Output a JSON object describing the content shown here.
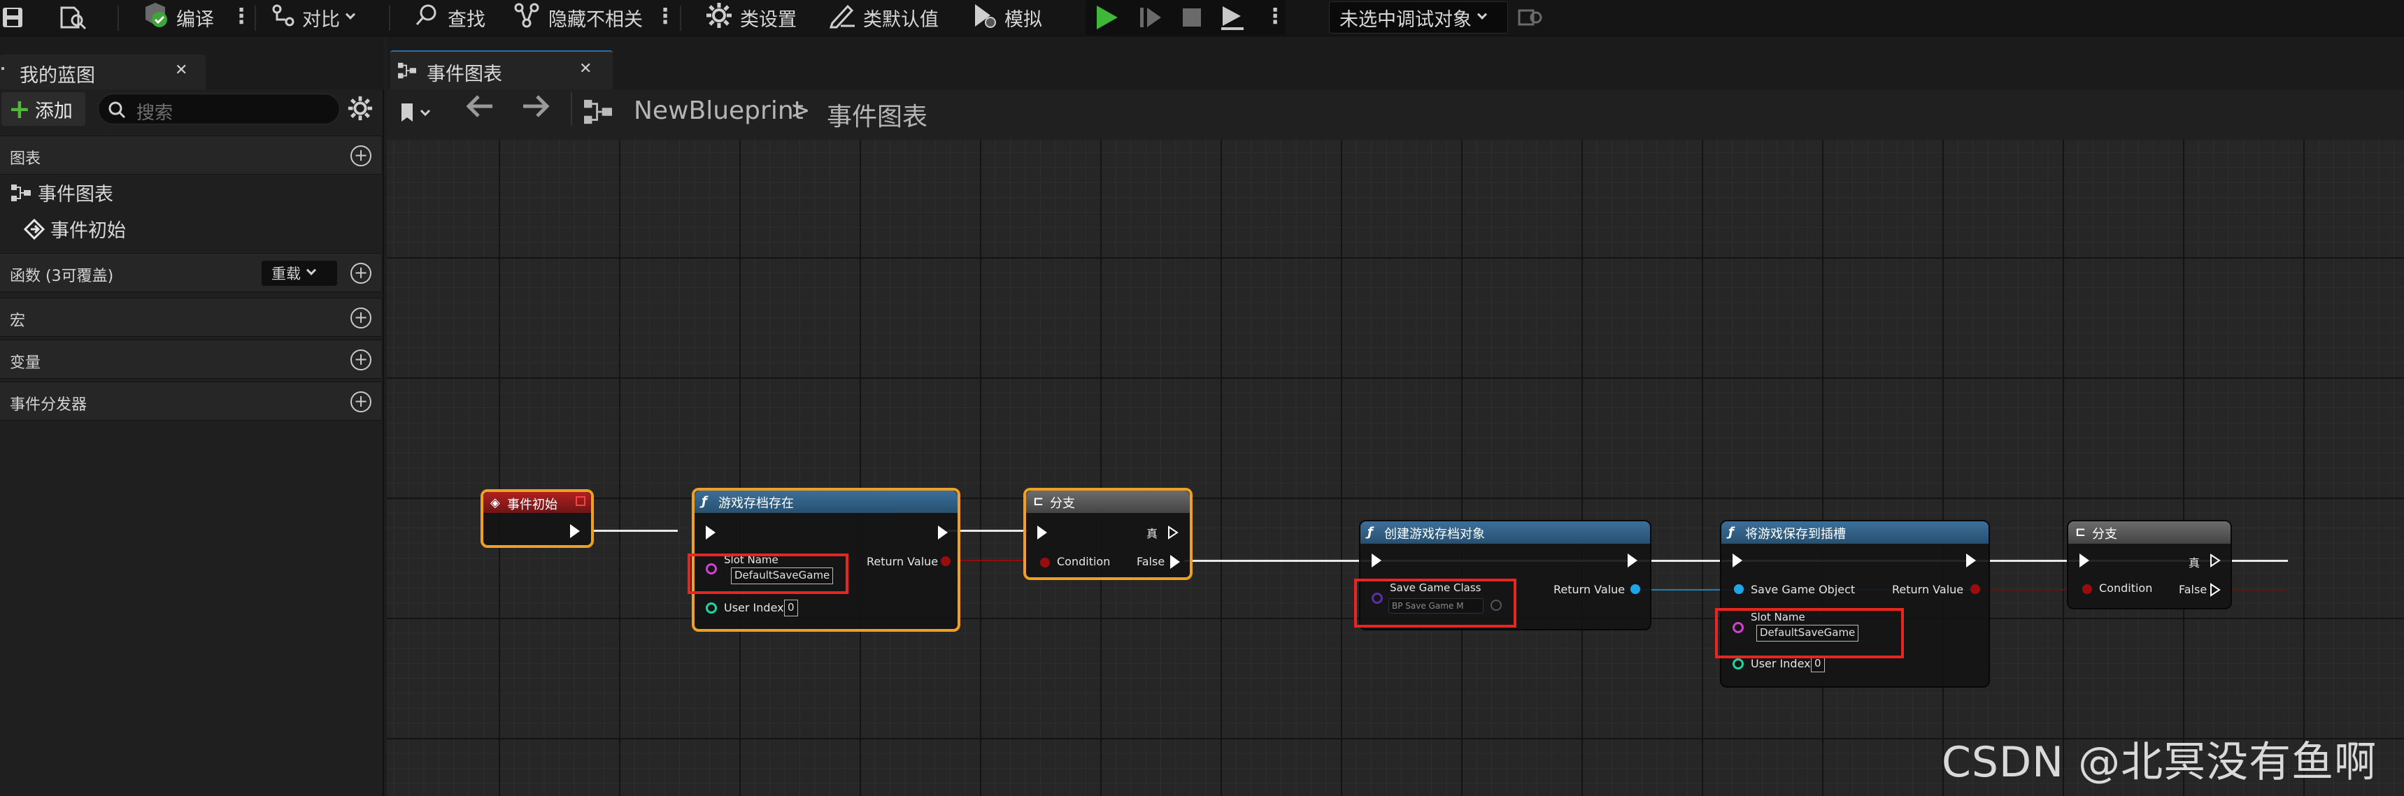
{
  "toolbar": {
    "compile": "编译",
    "diff": "对比",
    "find": "查找",
    "hide_unrelated": "隐藏不相关",
    "class_settings": "类设置",
    "class_defaults": "类默认值",
    "simulate": "模拟",
    "debug_target": "未选中调试对象"
  },
  "left": {
    "tab_label": "我的蓝图",
    "add_label": "添加",
    "search_placeholder": "搜索",
    "sections": {
      "graphs": "图表",
      "functions": "函数 (3可覆盖)",
      "override_label": "重载",
      "macros": "宏",
      "variables": "变量",
      "dispatchers": "事件分发器"
    },
    "graph_items": [
      "事件图表",
      "事件初始"
    ]
  },
  "graph": {
    "tab_label": "事件图表",
    "breadcrumb_root": "NewBlueprint",
    "breadcrumb_leaf": "事件图表"
  },
  "nodes": {
    "begin_play": {
      "title": "事件初始"
    },
    "does_save_exist": {
      "title": "游戏存档存在",
      "slot_name_label": "Slot Name",
      "slot_name_value": "DefaultSaveGame",
      "return_label": "Return Value",
      "user_index_label": "User Index",
      "user_index_value": "0"
    },
    "branch1": {
      "title": "分支",
      "condition": "Condition",
      "true_label": "真",
      "false_label": "False"
    },
    "create_save": {
      "title": "创建游戏存档对象",
      "class_label": "Save Game Class",
      "class_value": "BP Save Game M",
      "return_label": "Return Value"
    },
    "save_to_slot": {
      "title": "将游戏保存到插槽",
      "object_label": "Save Game Object",
      "return_label": "Return Value",
      "slot_name_label": "Slot Name",
      "slot_name_value": "DefaultSaveGame",
      "user_index_label": "User Index",
      "user_index_value": "0"
    },
    "branch2": {
      "title": "分支",
      "condition": "Condition",
      "true_label": "真",
      "false_label": "False"
    }
  },
  "watermark": "CSDN @北冥没有鱼啊",
  "colors": {
    "exec": "#ffffff",
    "string_pin": "#d33fd0",
    "int_pin": "#1fd6a0",
    "bool_pin": "#9b0d0d",
    "object_pin": "#1ea7e8",
    "class_pin": "#5b2ea8",
    "selected_outline": "#f0a020",
    "highlight_box": "#e8261f",
    "function_header": "#3b6f9a",
    "event_header": "#b02020"
  }
}
